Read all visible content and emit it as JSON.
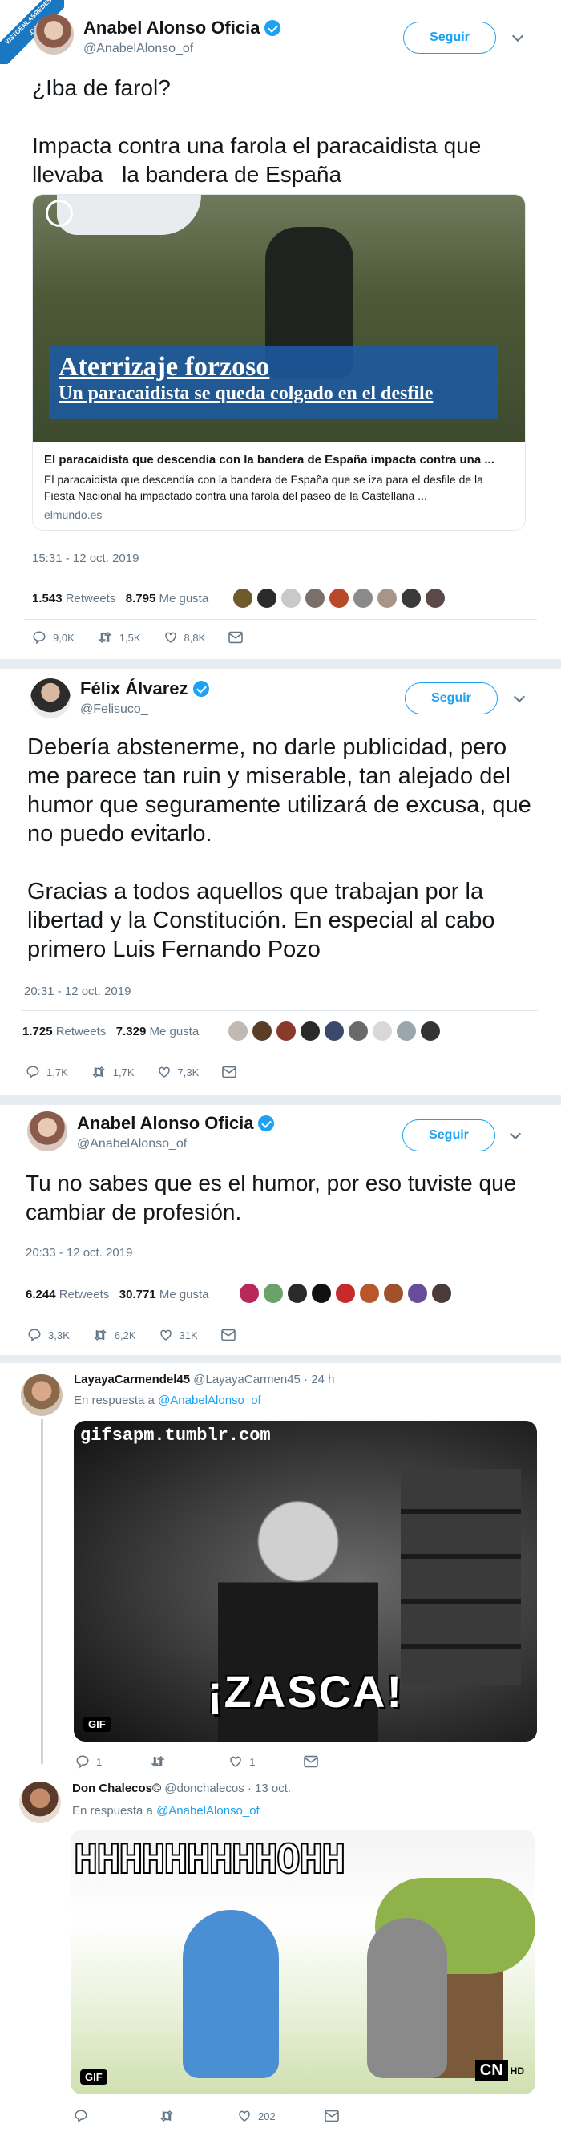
{
  "watermark": {
    "line1": "VISTOENLASREDES",
    "line2": ".COM"
  },
  "tweet1": {
    "name": "Anabel Alonso Oficia",
    "handle": "@AnabelAlonso_of",
    "follow_label": "Seguir",
    "text": "¿Iba de farol?\n\nImpacta contra una farola el paracaidista que llevaba   la bandera de España",
    "card": {
      "overlay_title": "Aterrizaje forzoso",
      "overlay_subtitle": "Un paracaidista se queda colgado en el desfile",
      "title": "El paracaidista que descendía con la bandera de España impacta contra una ...",
      "description": "El paracaidista que descendía con la bandera de España que se iza para el desfile de la Fiesta Nacional ha impactado contra una farola del paseo de la Castellana ...",
      "domain": "elmundo.es"
    },
    "timestamp": "15:31 - 12 oct. 2019",
    "retweets": "1.543",
    "retweets_label": "Retweets",
    "likes": "8.795",
    "likes_label": "Me gusta",
    "replies_count": "9,0K",
    "rt_count": "1,5K",
    "like_count": "8,8K"
  },
  "tweet2": {
    "name": "Félix Álvarez",
    "handle": "@Felisuco_",
    "follow_label": "Seguir",
    "text": "Debería abstenerme, no darle publicidad, pero me parece tan ruin y miserable, tan alejado del humor que seguramente utilizará de excusa, que no puedo evitarlo.\n\nGracias a todos aquellos que trabajan por la libertad y la Constitución. En especial al cabo primero Luis Fernando Pozo",
    "timestamp": "20:31 - 12 oct. 2019",
    "retweets": "1.725",
    "retweets_label": "Retweets",
    "likes": "7.329",
    "likes_label": "Me gusta",
    "replies_count": "1,7K",
    "rt_count": "1,7K",
    "like_count": "7,3K"
  },
  "tweet3": {
    "name": "Anabel Alonso Oficia",
    "handle": "@AnabelAlonso_of",
    "follow_label": "Seguir",
    "text": "Tu no sabes que es el humor, por eso tuviste que cambiar de profesión.",
    "timestamp": "20:33 - 12 oct. 2019",
    "retweets": "6.244",
    "retweets_label": "Retweets",
    "likes": "30.771",
    "likes_label": "Me gusta",
    "replies_count": "3,3K",
    "rt_count": "6,2K",
    "like_count": "31K"
  },
  "reply1": {
    "name": "LayayaCarmendel45",
    "handle": "@LayayaCarmen45",
    "time": "· 24 h",
    "reply_prefix": "En respuesta a",
    "reply_to": "@AnabelAlonso_of",
    "gif_watermark": "gifsapm.tumblr.com",
    "gif_caption": "¡ZASCA!",
    "gif_badge": "GIF",
    "replies_count": "1",
    "rt_count": "",
    "like_count": "1"
  },
  "reply2": {
    "name": "Don Chalecos©",
    "handle": "@donchalecos",
    "time": "· 13 oct.",
    "reply_prefix": "En respuesta a",
    "reply_to": "@AnabelAlonso_of",
    "gif_caption": "HHHHHHHHHOHH",
    "gif_badge": "GIF",
    "gif_logo": "CN",
    "gif_logo_suffix": "HD",
    "replies_count": "",
    "rt_count": "",
    "like_count": "202"
  },
  "colors": {
    "accent": "#1da1f2",
    "muted": "#657786",
    "divider": "#e1e8ed",
    "text": "#14171a"
  }
}
